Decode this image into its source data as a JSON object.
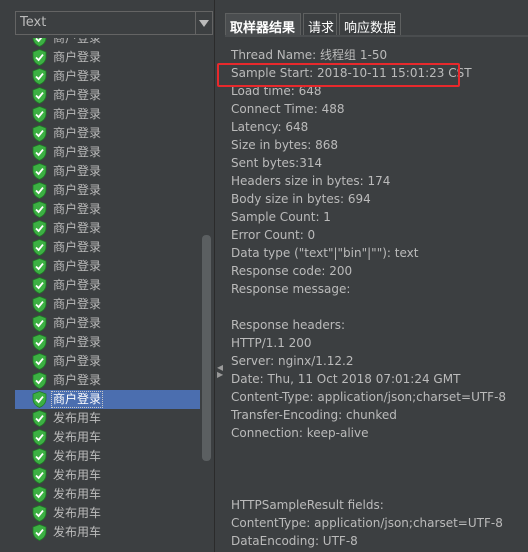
{
  "renderer": {
    "selected": "Text"
  },
  "tabs": [
    {
      "label": "取样器结果",
      "active": true
    },
    {
      "label": "请求",
      "active": false
    },
    {
      "label": "响应数据",
      "active": false
    }
  ],
  "results": [
    {
      "label": "商户登录",
      "status": "success"
    },
    {
      "label": "商户登录",
      "status": "success"
    },
    {
      "label": "商户登录",
      "status": "success"
    },
    {
      "label": "商户登录",
      "status": "success"
    },
    {
      "label": "商户登录",
      "status": "success"
    },
    {
      "label": "商户登录",
      "status": "success"
    },
    {
      "label": "商户登录",
      "status": "success"
    },
    {
      "label": "商户登录",
      "status": "success"
    },
    {
      "label": "商户登录",
      "status": "success"
    },
    {
      "label": "商户登录",
      "status": "success"
    },
    {
      "label": "商户登录",
      "status": "success"
    },
    {
      "label": "商户登录",
      "status": "success"
    },
    {
      "label": "商户登录",
      "status": "success"
    },
    {
      "label": "商户登录",
      "status": "success"
    },
    {
      "label": "商户登录",
      "status": "success"
    },
    {
      "label": "商户登录",
      "status": "success"
    },
    {
      "label": "商户登录",
      "status": "success"
    },
    {
      "label": "商户登录",
      "status": "success"
    },
    {
      "label": "商户登录",
      "status": "success"
    },
    {
      "label": "商户登录",
      "status": "success",
      "selected": true
    },
    {
      "label": "发布用车",
      "status": "success"
    },
    {
      "label": "发布用车",
      "status": "success"
    },
    {
      "label": "发布用车",
      "status": "success"
    },
    {
      "label": "发布用车",
      "status": "success"
    },
    {
      "label": "发布用车",
      "status": "success"
    },
    {
      "label": "发布用车",
      "status": "success"
    },
    {
      "label": "发布用车",
      "status": "success"
    }
  ],
  "sampler_result": [
    "Thread Name: 线程组 1-50",
    "Sample Start: 2018-10-11 15:01:23 CST",
    "Load time: 648",
    "Connect Time: 488",
    "Latency: 648",
    "Size in bytes: 868",
    "Sent bytes:314",
    "Headers size in bytes: 174",
    "Body size in bytes: 694",
    "Sample Count: 1",
    "Error Count: 0",
    "Data type (\"text\"|\"bin\"|\"\"): text",
    "Response code: 200",
    "Response message: ",
    "",
    "Response headers:",
    "HTTP/1.1 200",
    "Server: nginx/1.12.2",
    "Date: Thu, 11 Oct 2018 07:01:24 GMT",
    "Content-Type: application/json;charset=UTF-8",
    "Transfer-Encoding: chunked",
    "Connection: keep-alive",
    "",
    "",
    "",
    "HTTPSampleResult fields:",
    "ContentType: application/json;charset=UTF-8",
    "DataEncoding: UTF-8"
  ],
  "colors": {
    "background": "#3c3f41",
    "selection": "#4b6eaf",
    "success_icon": "#3cb043",
    "highlight_border": "#e8292c"
  },
  "icons": {
    "status_success": "green-shield-check-icon",
    "dropdown": "triangle-down-icon"
  }
}
